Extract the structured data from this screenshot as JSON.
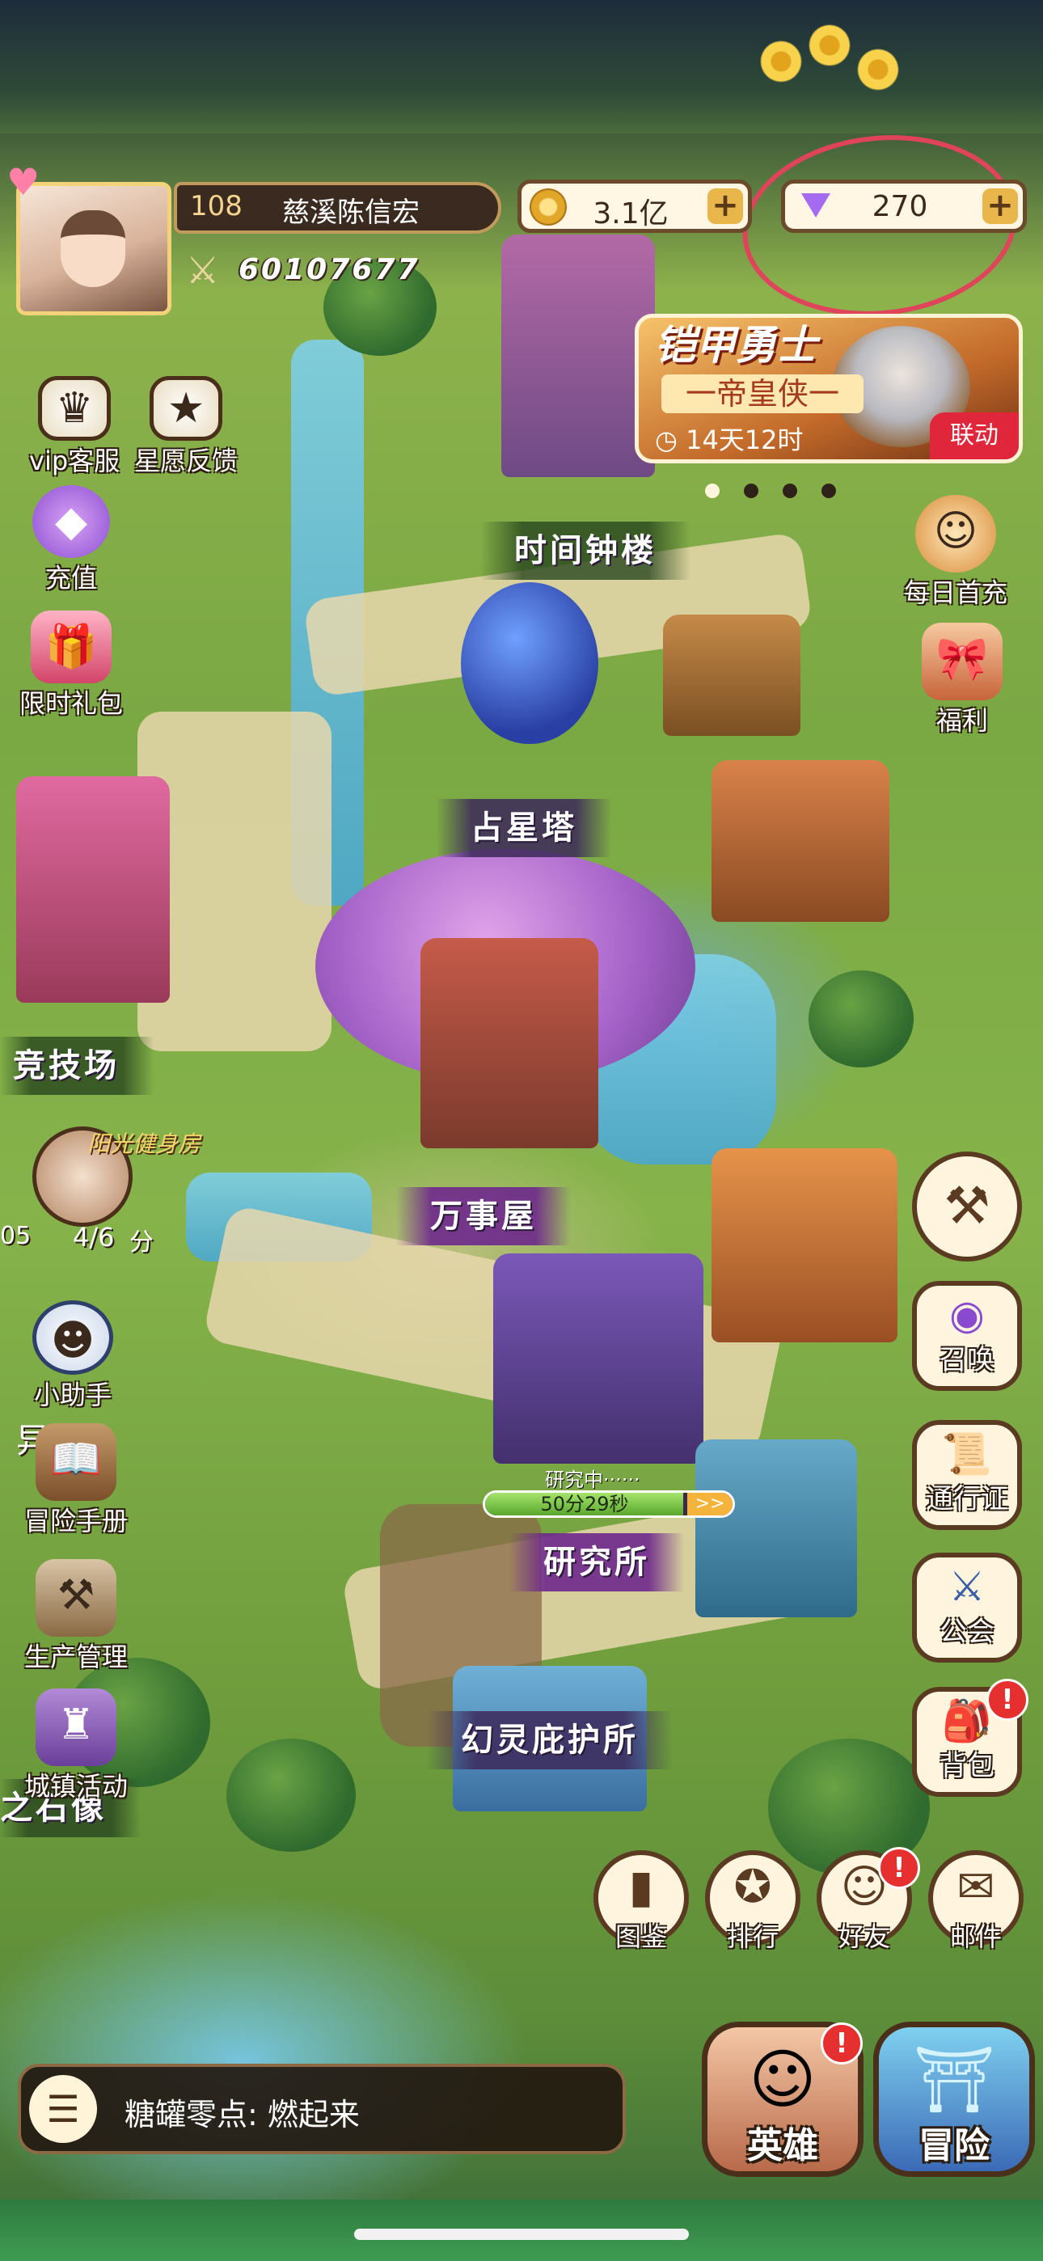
{
  "player": {
    "level": "108",
    "name": "慈溪陈信宏",
    "power": "60107677"
  },
  "resources": {
    "gold": "3.1亿",
    "gems": "270",
    "plus": "+"
  },
  "event_banner": {
    "brand": "铠甲勇士",
    "subtitle": "一帝皇侠一",
    "timer": "14天12时",
    "tag": "联动",
    "carousel_active_index": 0,
    "carousel_count": 4
  },
  "left_menu": [
    {
      "label": "vip客服",
      "icon": "crown-icon"
    },
    {
      "label": "星愿反馈",
      "icon": "star-card-icon"
    },
    {
      "label": "充值",
      "icon": "gem-pile-icon"
    },
    {
      "label": "限时礼包",
      "icon": "gift-box-icon"
    }
  ],
  "right_top_menu": [
    {
      "label": "每日首充",
      "icon": "character-icon"
    },
    {
      "label": "福利",
      "icon": "present-icon"
    }
  ],
  "buildings": {
    "time_tower": "时间钟楼",
    "star_tower": "占星塔",
    "arena": "竞技场",
    "general_store": "万事屋",
    "research": "研究所",
    "spirit_shelter": "幻灵庇护所",
    "stone_statue": "之石像",
    "gym_sign": "阳光健身房"
  },
  "arena_timer": {
    "count": "4/6",
    "prefix": "05",
    "suffix": "分"
  },
  "research_progress": {
    "status": "研究中······",
    "time": "50分29秒",
    "progress": 0.8,
    "speed": ">>"
  },
  "left_tools": [
    {
      "label": "小助手",
      "icon": "robot-icon"
    },
    {
      "label": "冒险手册",
      "icon": "book-icon"
    },
    {
      "label": "生产管理",
      "icon": "hammer-tools-icon"
    },
    {
      "label": "城镇活动",
      "icon": "castle-icon"
    }
  ],
  "partial_left_label": "异",
  "right_menu": [
    {
      "label": "",
      "icon": "build-hammer-icon"
    },
    {
      "label": "召唤",
      "icon": "summon-portal-icon"
    },
    {
      "label": "通行证",
      "icon": "pass-scroll-icon"
    },
    {
      "label": "公会",
      "icon": "swords-shield-icon"
    },
    {
      "label": "背包",
      "icon": "backpack-icon",
      "badge": "!"
    }
  ],
  "bottom_menu": [
    {
      "label": "图鉴",
      "icon": "codex-book-icon"
    },
    {
      "label": "排行",
      "icon": "medal-icon"
    },
    {
      "label": "好友",
      "icon": "friends-icon",
      "badge": "!"
    },
    {
      "label": "邮件",
      "icon": "mail-icon"
    }
  ],
  "chat": {
    "message": "糖罐零点: 燃起来"
  },
  "main_buttons": {
    "heroes": "英雄",
    "adventure": "冒险",
    "heroes_badge": "!"
  },
  "colors": {
    "annotation": "#e0445a",
    "badge": "#e62f2f",
    "label_purple": "#6e288c"
  }
}
